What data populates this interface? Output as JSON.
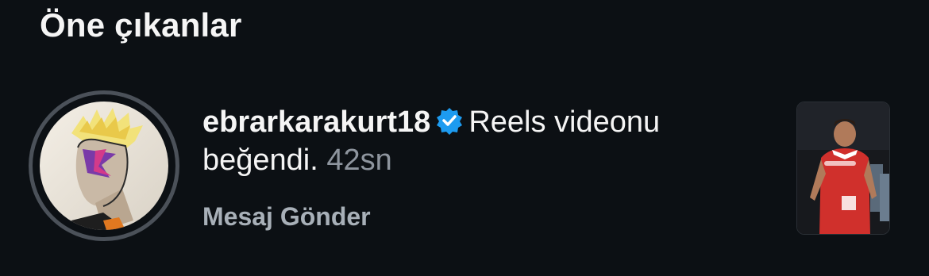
{
  "section": {
    "title": "Öne çıkanlar"
  },
  "notification": {
    "username": "ebrarkarakurt18",
    "verified": true,
    "action_text": "Reels videonu beğendi.",
    "time": "42sn",
    "send_message_label": "Mesaj Gönder",
    "avatar_icon": "profile-avatar-artwork",
    "thumbnail_icon": "reels-thumbnail",
    "colors": {
      "background": "#0c1014",
      "text": "#f5f5f5",
      "muted": "#8e959e",
      "verified": "#1d9bf0",
      "ring": "#4b5159"
    }
  }
}
